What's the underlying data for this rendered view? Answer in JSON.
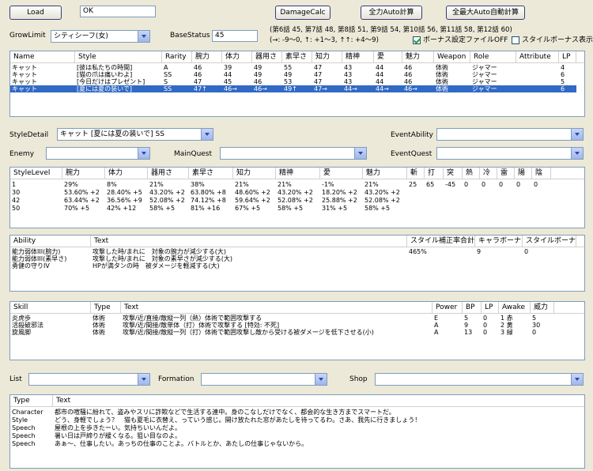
{
  "top": {
    "load_label": "Load",
    "status_value": "OK",
    "damagecalc_label": "DamageCalc",
    "auto_label": "全力Auto計算",
    "all_auto_label": "全最大Auto自動計算"
  },
  "params": {
    "growlimit_label": "GrowLimit",
    "growlimit_value": "シティシーフ(女)",
    "basestatus_label": "BaseStatus",
    "basestatus_value": "45",
    "episodes": "(第6話 45, 第7話 48, 第8話 51, 第9話 54, 第10話 56, 第11話 58, 第12話 60)",
    "legend": "(→: -9〜0, ↑: +1〜3, ↑↑: +4〜9)",
    "bonus_file_label": "ボーナス設定ファイルOFF",
    "bonus_file_checked": true,
    "style_bonus_label": "スタイルボーナス表示",
    "style_bonus_checked": false
  },
  "style_table": {
    "headers": [
      "Name",
      "Style",
      "Rarity",
      "腕力",
      "体力",
      "器用さ",
      "素早さ",
      "知力",
      "精神",
      "愛",
      "魅力",
      "Weapon",
      "Role",
      "Attribute",
      "LP"
    ],
    "rows": [
      [
        "キャット",
        "[彼は私たちの時間]",
        "A",
        "46",
        "39",
        "49",
        "55",
        "47",
        "43",
        "44",
        "46",
        "体術",
        "ジャマー",
        "",
        "4"
      ],
      [
        "キャット",
        "[猫の爪は痛いわよ]",
        "SS",
        "46",
        "44",
        "49",
        "49",
        "47",
        "43",
        "44",
        "46",
        "体術",
        "ジャマー",
        "",
        "6"
      ],
      [
        "キャット",
        "[今日だけはプレゼント]",
        "S",
        "47",
        "45",
        "46",
        "53",
        "47",
        "43",
        "44",
        "46",
        "体術",
        "ジャマー",
        "",
        "5"
      ],
      [
        "キャット",
        "[夏には夏の装いで]",
        "SS",
        "47↑",
        "46→",
        "46→",
        "49↑",
        "47→",
        "44→",
        "44→",
        "46→",
        "体術",
        "ジャマー",
        "",
        "6"
      ]
    ]
  },
  "selectors": {
    "styledetail_label": "StyleDetail",
    "styledetail_value": "キャット [夏には夏の装いで] SS",
    "eventability_label": "EventAbility",
    "eventability_value": "",
    "enemy_label": "Enemy",
    "enemy_value": "",
    "mainquest_label": "MainQuest",
    "mainquest_value": "",
    "eventquest_label": "EventQuest",
    "eventquest_value": ""
  },
  "level_table": {
    "headers": [
      "StyleLevel",
      "腕力",
      "体力",
      "器用さ",
      "素早さ",
      "知力",
      "精神",
      "愛",
      "魅力",
      "斬",
      "打",
      "突",
      "熱",
      "冷",
      "雷",
      "陽",
      "陰"
    ],
    "rows": [
      [
        "1",
        "29%",
        "8%",
        "21%",
        "38%",
        "21%",
        "21%",
        "-1%",
        "21%",
        "25",
        "65",
        "-45",
        "0",
        "0",
        "0",
        "0",
        "0"
      ],
      [
        "30",
        "53.60% +2",
        "28.40% +5",
        "43.20% +2",
        "63.80% +8",
        "48.60% +2",
        "43.20% +2",
        "18.20% +2",
        "43.20% +2",
        "",
        "",
        "",
        "",
        "",
        "",
        "",
        ""
      ],
      [
        "42",
        "63.44% +2",
        "36.56% +9",
        "52.08% +2",
        "74.12% +8",
        "59.64% +2",
        "52.08% +2",
        "25.88% +2",
        "52.08% +2",
        "",
        "",
        "",
        "",
        "",
        "",
        "",
        ""
      ],
      [
        "50",
        "70% +5",
        "42% +12",
        "58% +5",
        "81% +16",
        "67% +5",
        "58% +5",
        "31% +5",
        "58% +5",
        "",
        "",
        "",
        "",
        "",
        "",
        "",
        ""
      ]
    ]
  },
  "ability_table": {
    "headers": [
      "Ability",
      "Text",
      "スタイル補正率合計",
      "キャラボーナス",
      "スタイルボーナス"
    ],
    "rows": [
      [
        "能力弱体III(腕力)",
        "攻撃した時/まれに　対象の腕力が減少する(大)",
        "465%",
        "9",
        "0"
      ],
      [
        "能力弱体III(素早さ)",
        "攻撃した時/まれに　対象の素早さが減少する(大)",
        "",
        "",
        ""
      ],
      [
        "勇健の守りIV",
        "HPが満タンの時　被ダメージを軽減する(大)",
        "",
        "",
        ""
      ]
    ]
  },
  "skill_table": {
    "headers": [
      "Skill",
      "Type",
      "Text",
      "Power",
      "BP",
      "LP",
      "Awake",
      "威力"
    ],
    "rows": [
      [
        "炎虎歩",
        "体術",
        "攻撃/近/直接/敵縦一列（熱）体術で範囲攻撃する",
        "E",
        "5",
        "0",
        "1 赤",
        "5"
      ],
      [
        "活殺破邪法",
        "体術",
        "攻撃/近/間接/敵単体（打）体術で攻撃する [特効: 不死]",
        "A",
        "9",
        "0",
        "2 黄",
        "30"
      ],
      [
        "旋風脚",
        "体術",
        "攻撃/近/間接/敵縦一列（打）体術で範囲攻撃し敵から受ける被ダメージを低下させる(小)",
        "A",
        "13",
        "0",
        "3 緑",
        "0"
      ]
    ]
  },
  "bottom_selectors": {
    "list_label": "List",
    "list_value": "",
    "formation_label": "Formation",
    "formation_value": "",
    "shop_label": "Shop",
    "shop_value": ""
  },
  "text_table": {
    "headers": [
      "Type",
      "Text"
    ],
    "rows": [
      [
        "Character",
        "都市の喧騒に紛れて、盗みやスリに詐欺などで生活する連中。身のこなしだけでなく、都会的な生き方までスマートだ。"
      ],
      [
        "Style",
        "どう、身軽でしょう？　猫も夏毛に衣替え、っていう感じ。開け放たれた窓があたしを待ってるわ。さあ、我先に行きましょう！"
      ],
      [
        "Speech",
        "屋根の上を歩きたーい。気持ちいいんだよ。"
      ],
      [
        "Speech",
        "暑い日は戸締りが緩くなる。狙い目なのよ。"
      ],
      [
        "Speech",
        "あぁ～、仕事したい。あっちの仕事のことよ。バトルとか、あたしの仕事じゃないから。"
      ]
    ]
  }
}
